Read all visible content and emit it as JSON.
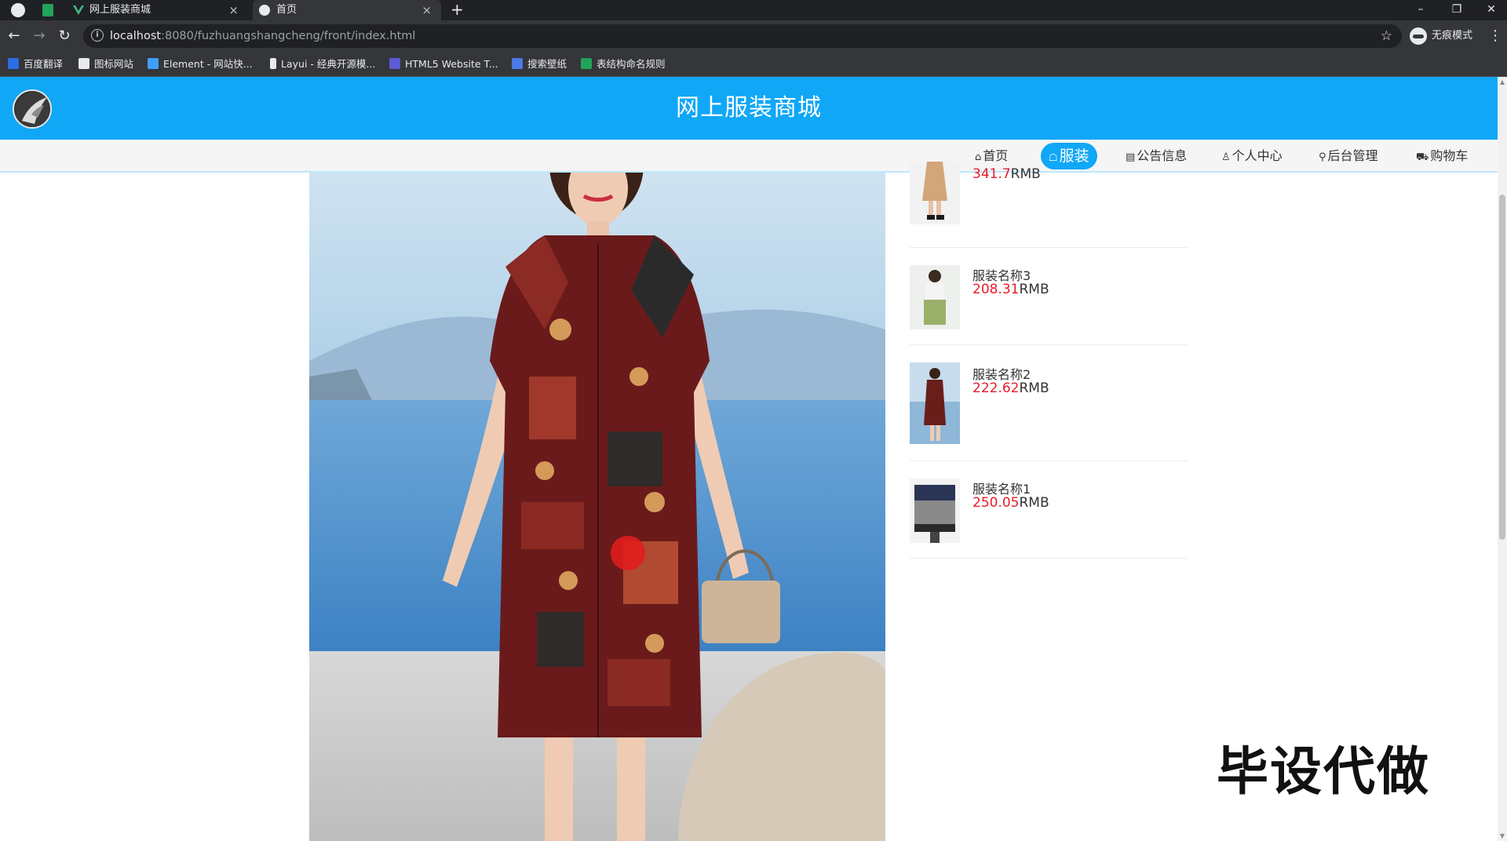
{
  "browser": {
    "tabs": [
      {
        "label": "网上服装商城",
        "active": false
      },
      {
        "label": "首页",
        "active": true
      }
    ],
    "close_glyph": "×",
    "new_tab_glyph": "+",
    "url_host": "localhost",
    "url_rest": ":8080/fuzhuangshangcheng/front/index.html",
    "incognito_label": "无痕模式",
    "bookmarks": [
      {
        "label": "百度翻译",
        "color": "#2b6de4"
      },
      {
        "label": "图标网站",
        "color": "#e8eaed"
      },
      {
        "label": "Element - 网站快...",
        "color": "#409eff"
      },
      {
        "label": "Layui - 经典开源模...",
        "color": "#e8eaed"
      },
      {
        "label": "HTML5 Website T...",
        "color": "#5b5bd6"
      },
      {
        "label": "搜索壁纸",
        "color": "#4a7be6"
      },
      {
        "label": "表结构命名规则",
        "color": "#22a35a"
      }
    ]
  },
  "site": {
    "title": "网上服装商城",
    "accent": "#10a7f7",
    "nav": [
      {
        "label": "首页",
        "icon": "home-icon",
        "active": false
      },
      {
        "label": "服装",
        "icon": "clothing-icon",
        "active": true
      },
      {
        "label": "公告信息",
        "icon": "notice-icon",
        "active": false
      },
      {
        "label": "个人中心",
        "icon": "user-icon",
        "active": false
      },
      {
        "label": "后台管理",
        "icon": "link-icon",
        "active": false
      },
      {
        "label": "购物车",
        "icon": "cart-icon",
        "active": false
      }
    ]
  },
  "products": [
    {
      "name": "",
      "price": "341.7",
      "currency": "RMB"
    },
    {
      "name": "服装名称3",
      "price": "208.31",
      "currency": "RMB"
    },
    {
      "name": "服装名称2",
      "price": "222.62",
      "currency": "RMB"
    },
    {
      "name": "服装名称1",
      "price": "250.05",
      "currency": "RMB"
    }
  ],
  "watermark": "毕设代做"
}
